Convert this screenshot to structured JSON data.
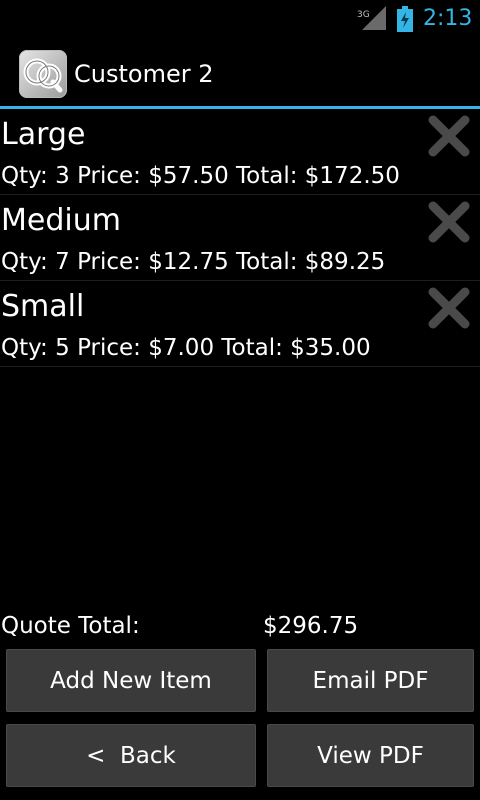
{
  "status_bar": {
    "network_label": "3G",
    "time": "2:13",
    "accent_color": "#33b5e5"
  },
  "action_bar": {
    "icon": "cq-app-icon",
    "icon_letters": "CQ",
    "title": "Customer 2"
  },
  "items": [
    {
      "name": "Large",
      "details": "Qty: 3 Price: $57.50 Total: $172.50",
      "delete_icon": "close-x-icon"
    },
    {
      "name": "Medium",
      "details": "Qty: 7 Price: $12.75 Total: $89.25",
      "delete_icon": "close-x-icon"
    },
    {
      "name": "Small",
      "details": "Qty: 5 Price: $7.00 Total: $35.00",
      "delete_icon": "close-x-icon"
    }
  ],
  "footer": {
    "total_label": "Quote Total:",
    "total_value": "$296.75",
    "buttons": {
      "add": "Add New Item",
      "email": "Email PDF",
      "back": "<  Back",
      "view": "View PDF"
    }
  }
}
